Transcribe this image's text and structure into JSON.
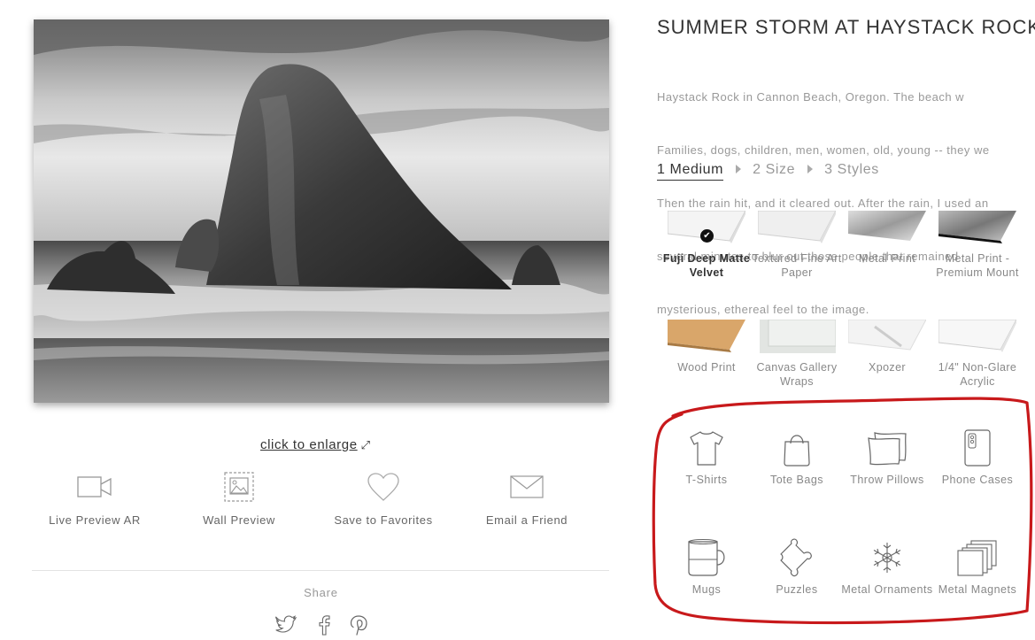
{
  "artwork": {
    "title": "SUMMER STORM AT HAYSTACK ROCK",
    "description_lines": [
      "Haystack Rock in Cannon Beach, Oregon. The beach w",
      "Families, dogs, children, men, women, old, young -- they we",
      "Then the rain hit, and it cleared out. After the rain, I used an",
      "several minutes to blur out those people that remained",
      "mysterious, ethereal feel to the image."
    ]
  },
  "enlarge_label": "click to enlarge",
  "actions": [
    {
      "label": "Live Preview AR",
      "icon": "video-camera-icon"
    },
    {
      "label": "Wall Preview",
      "icon": "picture-frame-icon"
    },
    {
      "label": "Save to Favorites",
      "icon": "heart-icon"
    },
    {
      "label": "Email a Friend",
      "icon": "envelope-icon"
    }
  ],
  "share": {
    "label": "Share",
    "networks": [
      "twitter-icon",
      "facebook-icon",
      "pinterest-icon"
    ]
  },
  "steps": [
    {
      "label": "1 Medium",
      "active": true
    },
    {
      "label": "2 Size",
      "active": false
    },
    {
      "label": "3 Styles",
      "active": false
    }
  ],
  "mediums": [
    {
      "label": "Fuji Deep Matte Velvet",
      "selected": true
    },
    {
      "label": "Textured Fine Art Paper",
      "selected": false
    },
    {
      "label": "Metal Print",
      "selected": false
    },
    {
      "label": "Metal Print - Premium Mount",
      "selected": false
    },
    {
      "label": "Wood Print",
      "selected": false
    },
    {
      "label": "Canvas Gallery Wraps",
      "selected": false
    },
    {
      "label": "Xpozer",
      "selected": false
    },
    {
      "label": "1/4\" Non-Glare Acrylic",
      "selected": false
    }
  ],
  "products": [
    {
      "label": "T-Shirts",
      "icon": "tshirt-icon"
    },
    {
      "label": "Tote Bags",
      "icon": "tote-bag-icon"
    },
    {
      "label": "Throw Pillows",
      "icon": "pillow-icon"
    },
    {
      "label": "Phone Cases",
      "icon": "phone-case-icon"
    },
    {
      "label": "Mugs",
      "icon": "mug-icon"
    },
    {
      "label": "Puzzles",
      "icon": "puzzle-icon"
    },
    {
      "label": "Metal Ornaments",
      "icon": "snowflake-ornament-icon"
    },
    {
      "label": "Metal Magnets",
      "icon": "magnets-icon"
    }
  ],
  "colors": {
    "annotation_circle": "#c8191b",
    "text_dark": "#333333",
    "text_muted": "#999999"
  }
}
